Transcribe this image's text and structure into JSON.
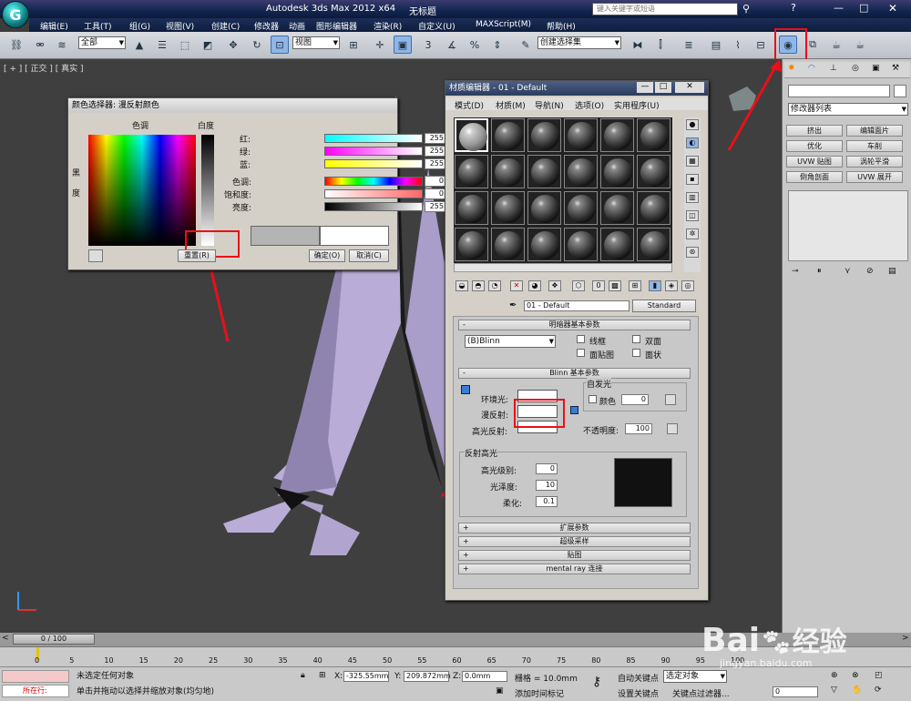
{
  "title_bar": {
    "app": "Autodesk 3ds Max  2012 x64",
    "doc": "无标题",
    "search_placeholder": "键入关键字或短语"
  },
  "menu": [
    "编辑(E)",
    "工具(T)",
    "组(G)",
    "视图(V)",
    "创建(C)",
    "修改器",
    "动画",
    "图形编辑器",
    "渲染(R)",
    "自定义(U)",
    "MAXScript(M)",
    "帮助(H)"
  ],
  "toolbar": {
    "selection_filter": "全部",
    "ref_coord": "视图",
    "named_selection": "创建选择集",
    "snap_3": "3",
    "snap_25": "2.5",
    "snap_percent": "%"
  },
  "viewport": {
    "label": "[ + ] [ 正交 ] [ 真实 ]"
  },
  "color_picker": {
    "title": "颜色选择器: 漫反射颜色",
    "hue_label": "色调",
    "white_label": "白度",
    "black_label": "黑度",
    "channels": [
      {
        "label": "红:",
        "value": "255"
      },
      {
        "label": "绿:",
        "value": "255"
      },
      {
        "label": "蓝:",
        "value": "255"
      },
      {
        "label": "色调:",
        "value": "0"
      },
      {
        "label": "饱和度:",
        "value": "0"
      },
      {
        "label": "亮度:",
        "value": "255"
      }
    ],
    "reset_button": "重置(R)",
    "ok_button": "确定(O)",
    "cancel_button": "取消(C)"
  },
  "material_editor": {
    "title": "材质编辑器 - 01 - Default",
    "menu": [
      "模式(D)",
      "材质(M)",
      "导航(N)",
      "选项(O)",
      "实用程序(U)"
    ],
    "material_name": "01 - Default",
    "material_type": "Standard",
    "shader_rollout": "明暗器基本参数",
    "shader": "(B)Blinn",
    "options": [
      "线框",
      "双面",
      "面贴图",
      "面状"
    ],
    "blinn_rollout": "Blinn 基本参数",
    "ambient": "环境光:",
    "diffuse": "漫反射:",
    "specular": "高光反射:",
    "self_illum": "自发光",
    "color_label": "颜色",
    "self_illum_value": "0",
    "opacity_label": "不透明度:",
    "opacity_value": "100",
    "spec_highlights": "反射高光",
    "specular_level_label": "高光级别:",
    "specular_level": "0",
    "glossiness_label": "光泽度:",
    "glossiness": "10",
    "soften_label": "柔化:",
    "soften": "0.1",
    "rollouts": [
      "扩展参数",
      "超级采样",
      "贴图",
      "mental ray 连接"
    ]
  },
  "command_panel": {
    "modifier_list": "修改器列表",
    "buttons": [
      "挤出",
      "编辑面片",
      "优化",
      "车削",
      "UVW 贴图",
      "涡轮平滑",
      "倒角剖面",
      "UVW 展开"
    ]
  },
  "timeline": {
    "frame": "0 / 100",
    "ticks": [
      "0",
      "5",
      "10",
      "15",
      "20",
      "25",
      "30",
      "35",
      "40",
      "45",
      "50",
      "55",
      "60",
      "65",
      "70",
      "75",
      "80",
      "85",
      "90",
      "95",
      "100"
    ]
  },
  "status": {
    "running": "所在行:",
    "selection": "未选定任何对象",
    "hint": "单击并拖动以选择并缩放对象(均匀地)",
    "x": "-325.55mm",
    "y": "209.872mm",
    "z": "0.0mm",
    "grid": "栅格 = 10.0mm",
    "add_time_tag": "添加时间标记",
    "auto_key": "自动关键点",
    "selected": "选定对象",
    "set_key": "设置关键点",
    "key_filter": "关键点过滤器...",
    "frame_value": "0"
  },
  "watermark": {
    "brand": "Bai",
    "brand2": "经验",
    "url": "jingyan.baidu.com"
  },
  "colors": {
    "highlight": "#e8101a",
    "object": "#b9acd6"
  }
}
